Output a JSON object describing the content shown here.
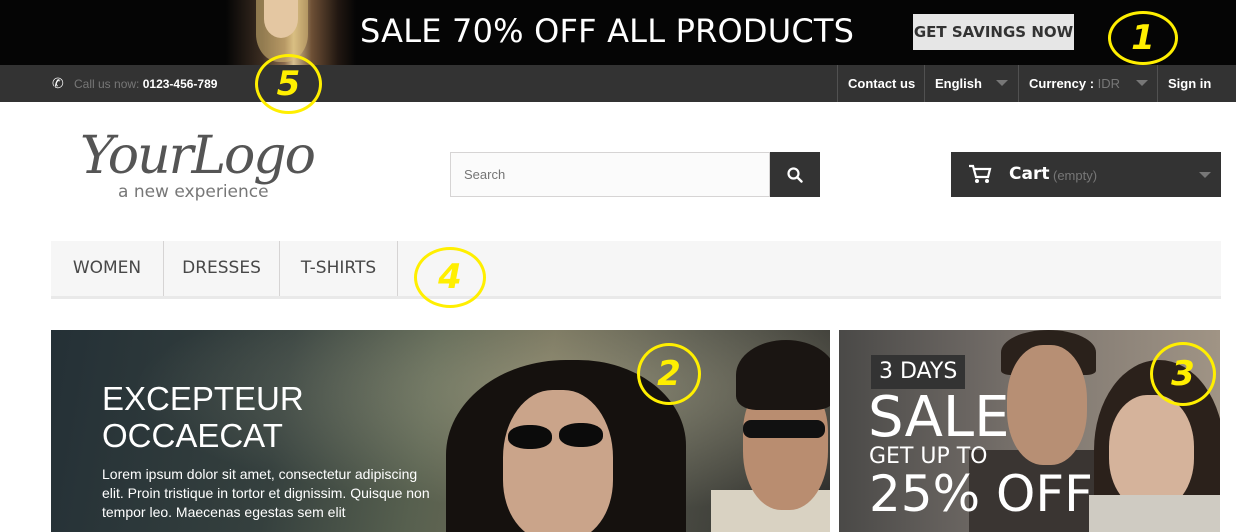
{
  "promo": {
    "headline": "SALE 70% OFF ALL PRODUCTS",
    "cta": "GET SAVINGS NOW"
  },
  "topbar": {
    "phone_label": "Call us now:",
    "phone_number": "0123-456-789",
    "contact": "Contact us",
    "language": "English",
    "currency_label": "Currency :",
    "currency_value": "IDR",
    "signin": "Sign in"
  },
  "header": {
    "logo_script": "YourLogo",
    "logo_tagline": "a new experience",
    "search_placeholder": "Search",
    "cart_label": "Cart",
    "cart_status": "(empty)"
  },
  "menu": {
    "items": [
      "WOMEN",
      "DRESSES",
      "T-SHIRTS"
    ]
  },
  "slider": {
    "title": "EXCEPTEUR OCCAECAT",
    "body": "Lorem ipsum dolor sit amet, consectetur adipiscing elit. Proin tristique in tortor et dignissim. Quisque non tempor leo. Maecenas egestas sem elit"
  },
  "side_banner": {
    "tag": "3 DAYS",
    "line1": "SALE",
    "line2": "GET UP TO",
    "line3": "25% OFF"
  },
  "annotations": {
    "m1": "1",
    "m2": "2",
    "m3": "3",
    "m4": "4",
    "m5": "5"
  },
  "colors": {
    "dark": "#333333",
    "marker": "#ffef00",
    "menu_bg": "#f6f6f6"
  }
}
